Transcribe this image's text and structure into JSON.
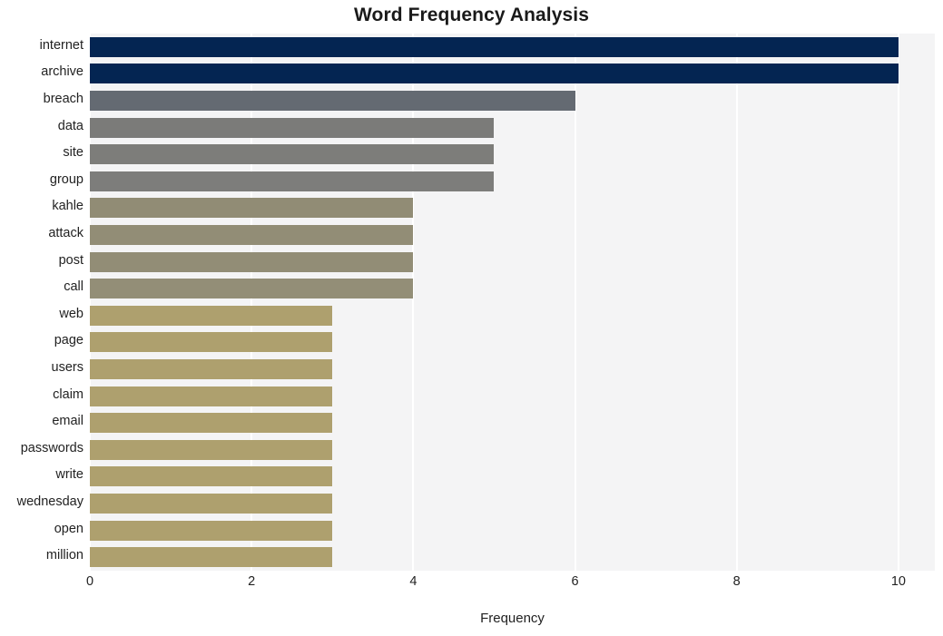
{
  "chart_data": {
    "type": "bar",
    "orientation": "horizontal",
    "title": "Word Frequency Analysis",
    "xlabel": "Frequency",
    "ylabel": "",
    "xlim": [
      0,
      10.45
    ],
    "xticks": [
      0,
      2,
      4,
      6,
      8,
      10
    ],
    "xtick_labels": [
      "0",
      "2",
      "4",
      "6",
      "8",
      "10"
    ],
    "grid": "vertical-white-on-gray",
    "legend": "none",
    "plot_background": "#f4f4f5",
    "categories": [
      "internet",
      "archive",
      "breach",
      "data",
      "site",
      "group",
      "kahle",
      "attack",
      "post",
      "call",
      "web",
      "page",
      "users",
      "claim",
      "email",
      "passwords",
      "write",
      "wednesday",
      "open",
      "million"
    ],
    "values": [
      10,
      10,
      6,
      5,
      5,
      5,
      4,
      4,
      4,
      4,
      3,
      3,
      3,
      3,
      3,
      3,
      3,
      3,
      3,
      3
    ],
    "bar_colors": [
      "#042552",
      "#042552",
      "#646a72",
      "#7b7b79",
      "#7d7d7a",
      "#7d7d7b",
      "#918c75",
      "#928d76",
      "#928d76",
      "#938e77",
      "#aea06e",
      "#aea06e",
      "#aea06e",
      "#aea06e",
      "#aea06e",
      "#aea06e",
      "#aea06e",
      "#aea06e",
      "#aea06e",
      "#aea06e"
    ]
  }
}
